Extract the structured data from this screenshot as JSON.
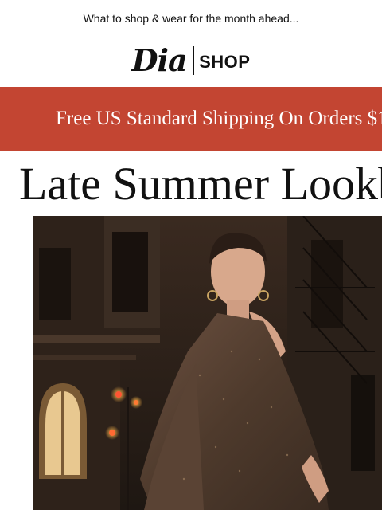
{
  "preheader": {
    "text": "What to shop & wear for the month ahead..."
  },
  "logo": {
    "brand": "Dia",
    "shop": "SHOP"
  },
  "banner": {
    "text": "Free US Standard Shipping On Orders $1",
    "color": "#c34532"
  },
  "headline": {
    "text": "Late Summer Lookb"
  },
  "hero": {
    "image_icon": "fashion-photo-icon"
  }
}
